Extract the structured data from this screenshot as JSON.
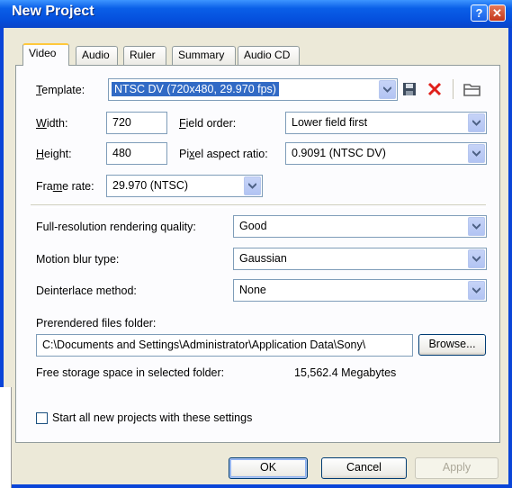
{
  "window": {
    "title": "New Project",
    "help_label": "?",
    "close_label": "✕"
  },
  "tabs": [
    "Video",
    "Audio",
    "Ruler",
    "Summary",
    "Audio CD"
  ],
  "active_tab": "Video",
  "video": {
    "template_label": "Template:",
    "template_value": "NTSC DV (720x480, 29.970 fps)",
    "width_label": "Width:",
    "width_value": "720",
    "height_label": "Height:",
    "height_value": "480",
    "field_order_label": "Field order:",
    "field_order_value": "Lower field first",
    "pixel_aspect_label": "Pixel aspect ratio:",
    "pixel_aspect_value": "0.9091 (NTSC DV)",
    "frame_rate_label": "Frame rate:",
    "frame_rate_value": "29.970 (NTSC)",
    "render_quality_label": "Full-resolution rendering quality:",
    "render_quality_value": "Good",
    "motion_blur_label": "Motion blur type:",
    "motion_blur_value": "Gaussian",
    "deinterlace_label": "Deinterlace method:",
    "deinterlace_value": "None",
    "prerender_folder_label": "Prerendered files folder:",
    "prerender_folder_value": "C:\\Documents and Settings\\Administrator\\Application Data\\Sony\\",
    "browse_label": "Browse...",
    "free_space_label": "Free storage space in selected folder:",
    "free_space_value": "15,562.4 Megabytes",
    "start_all_label": "Start all new projects with these settings"
  },
  "footer": {
    "ok_label": "OK",
    "cancel_label": "Cancel",
    "apply_label": "Apply"
  },
  "colors": {
    "title_bar": "#0a55e0",
    "dialog_bg": "#ece9d8",
    "panel_bg": "#fcfcfe",
    "delete_red": "#e0201b",
    "tab_highlight": "#ffc83c"
  },
  "icons": [
    "save-icon",
    "delete-icon",
    "open-folder-icon",
    "chevron-down-icon"
  ]
}
